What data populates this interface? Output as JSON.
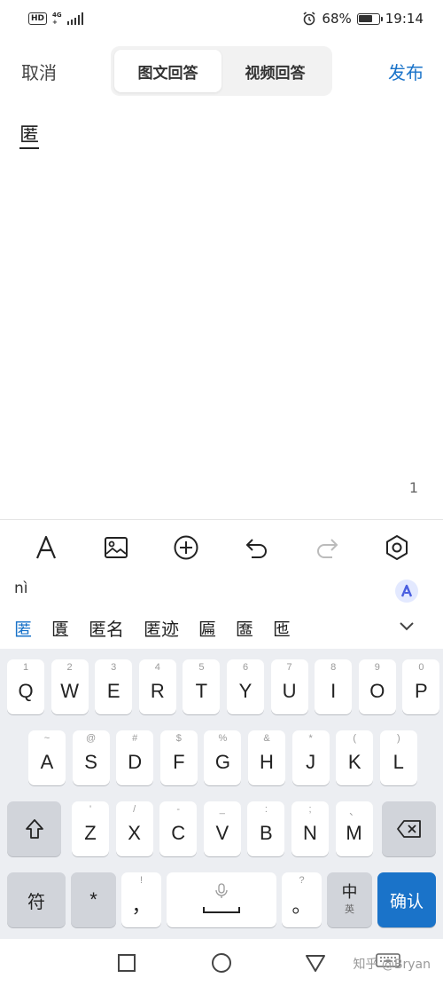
{
  "status": {
    "hd": "HD",
    "network_top": "4G",
    "network_bottom": "+",
    "battery": "68%",
    "battery_level": 0.68,
    "time": "19:14",
    "icons": [
      "alarm-icon",
      "signal-icon",
      "battery-icon"
    ]
  },
  "header": {
    "cancel": "取消",
    "tabs": [
      {
        "label": "图文回答",
        "active": true
      },
      {
        "label": "视频回答",
        "active": false
      }
    ],
    "publish": "发布",
    "accent": "#1a73c9"
  },
  "editor": {
    "composing_text": "匿",
    "char_count": "1"
  },
  "toolbar": {
    "items": [
      "text-format-icon",
      "image-icon",
      "add-circle-icon",
      "undo-icon",
      "redo-icon",
      "settings-icon"
    ]
  },
  "ime": {
    "pinyin": "nì",
    "candidates": [
      "匿",
      "匱",
      "匿名",
      "匿迹",
      "匾",
      "匲",
      "匜"
    ],
    "rows": [
      [
        {
          "k": "Q",
          "h": "1"
        },
        {
          "k": "W",
          "h": "2"
        },
        {
          "k": "E",
          "h": "3"
        },
        {
          "k": "R",
          "h": "4"
        },
        {
          "k": "T",
          "h": "5"
        },
        {
          "k": "Y",
          "h": "6"
        },
        {
          "k": "U",
          "h": "7"
        },
        {
          "k": "I",
          "h": "8"
        },
        {
          "k": "O",
          "h": "9"
        },
        {
          "k": "P",
          "h": "0"
        }
      ],
      [
        {
          "k": "A",
          "h": "~"
        },
        {
          "k": "S",
          "h": "@"
        },
        {
          "k": "D",
          "h": "#"
        },
        {
          "k": "F",
          "h": "$"
        },
        {
          "k": "G",
          "h": "%"
        },
        {
          "k": "H",
          "h": "&"
        },
        {
          "k": "J",
          "h": "*"
        },
        {
          "k": "K",
          "h": "("
        },
        {
          "k": "L",
          "h": ")"
        }
      ],
      [
        {
          "k": "Z",
          "h": "'"
        },
        {
          "k": "X",
          "h": "/"
        },
        {
          "k": "C",
          "h": "-"
        },
        {
          "k": "V",
          "h": "_"
        },
        {
          "k": "B",
          "h": ":"
        },
        {
          "k": "N",
          "h": ";"
        },
        {
          "k": "M",
          "h": "、"
        }
      ]
    ],
    "symbol_key": "符",
    "star_key": "*",
    "comma_key": "，",
    "comma_hint": "!",
    "period_key": "。",
    "period_hint": "?",
    "lang_key": "中",
    "lang_sub": "英",
    "confirm_key": "确认"
  },
  "watermark": "知乎 @Bryan"
}
